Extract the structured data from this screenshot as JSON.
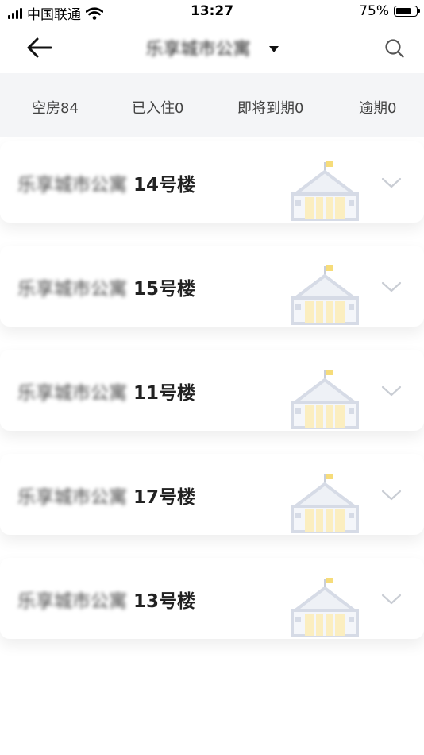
{
  "status_bar": {
    "carrier": "中国联通",
    "time": "13:27",
    "battery_percent": "75%",
    "battery_level": 0.75,
    "icons": [
      "signal-icon",
      "wifi-icon",
      "battery-icon"
    ]
  },
  "nav": {
    "title": "乐享城市公寓",
    "icons": [
      "back-arrow-icon",
      "caret-down-icon",
      "search-icon"
    ]
  },
  "stats": [
    {
      "label": "空房84"
    },
    {
      "label": "已入住0"
    },
    {
      "label": "即将到期0"
    },
    {
      "label": "逾期0"
    }
  ],
  "buildings": [
    {
      "name_prefix": "乐享城市公寓",
      "number": "14号楼"
    },
    {
      "name_prefix": "乐享城市公寓",
      "number": "15号楼"
    },
    {
      "name_prefix": "乐享城市公寓",
      "number": "11号楼"
    },
    {
      "name_prefix": "乐享城市公寓",
      "number": "17号楼"
    },
    {
      "name_prefix": "乐享城市公寓",
      "number": "13号楼"
    }
  ],
  "colors": {
    "stats_background": "#f4f5f7",
    "building_roof": "#d6dbe6",
    "building_window": "#fbeec0",
    "building_flag": "#f6dc7a",
    "chevron": "#c9cdd4"
  }
}
